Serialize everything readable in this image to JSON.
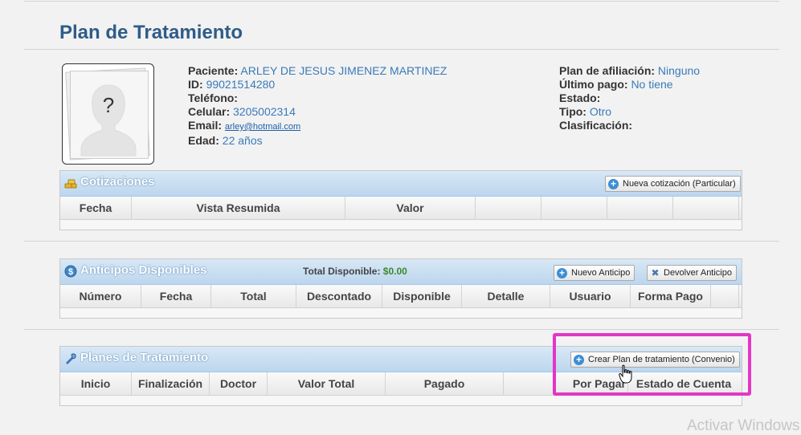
{
  "page": {
    "title": "Plan de Tratamiento"
  },
  "patient": {
    "name_label": "Paciente:",
    "name": "ARLEY DE JESUS JIMENEZ MARTINEZ",
    "id_label": "ID:",
    "id": "99021514280",
    "phone_label": "Teléfono:",
    "phone": "",
    "mobile_label": "Celular:",
    "mobile": "3205002314",
    "email_label": "Email:",
    "email": "arley@hotmail.com",
    "age_label": "Edad:",
    "age": "22 años",
    "avatar_placeholder": "?"
  },
  "plan_info": {
    "affiliation_label": "Plan de afiliación:",
    "affiliation": "Ninguno",
    "last_payment_label": "Último pago:",
    "last_payment": "No tiene",
    "status_label": "Estado:",
    "status": "",
    "type_label": "Tipo:",
    "type": "Otro",
    "classification_label": "Clasificación:",
    "classification": ""
  },
  "quotes": {
    "title": "Cotizaciones",
    "new_button": "Nueva cotización (Particular)",
    "columns": [
      "Fecha",
      "Vista Resumida",
      "Valor",
      "",
      "",
      "",
      ""
    ]
  },
  "advances": {
    "title": "Anticipos Disponibles",
    "total_label": "Total Disponible:",
    "total_value": "$0.00",
    "new_button": "Nuevo Anticipo",
    "return_button": "Devolver Anticipo",
    "columns": [
      "Número",
      "Fecha",
      "Total",
      "Descontado",
      "Disponible",
      "Detalle",
      "Usuario",
      "Forma Pago",
      ""
    ]
  },
  "plans": {
    "title": "Planes de Tratamiento",
    "create_button": "Crear Plan de tratamiento (Convenio)",
    "columns": [
      "Inicio",
      "Finalización",
      "Doctor",
      "Valor Total",
      "Pagado",
      "Por Pagar",
      "Estado de Cuenta"
    ]
  },
  "watermark": "Activar Windows",
  "colors": {
    "accent": "#2f5c88",
    "link": "#3a7ab8",
    "highlight": "#e336c5",
    "money": "#3b8a2e"
  }
}
